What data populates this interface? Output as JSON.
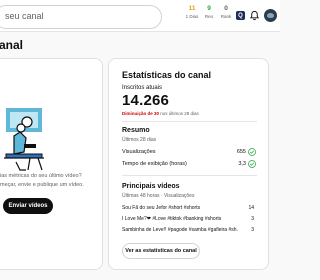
{
  "topbar": {
    "search_placeholder": "seu canal",
    "stats": [
      {
        "value": "11",
        "label": "1 Dias",
        "color": "amber"
      },
      {
        "value": "9",
        "label": "Reo",
        "color": "green"
      },
      {
        "value": "0",
        "label": "Rank",
        "color": "gray"
      }
    ],
    "badge": "Q",
    "icons": {
      "bell": "bell-icon",
      "avatar": "avatar"
    }
  },
  "page": {
    "title": "anal"
  },
  "left_card": {
    "prompt_lines": [
      "ias métricas do seu último vídeo?",
      "meçar, envie e publique um vídeo."
    ],
    "upload_button": "Enviar vídeos"
  },
  "analytics": {
    "title": "Estatísticas do canal",
    "subscribers_label": "Inscritos atuais",
    "subscribers_count": "14.266",
    "delta_value": "Diminuição de 30",
    "delta_suffix": "nos últimos 28 dias",
    "summary_title": "Resumo",
    "summary_period": "Últimos 28 dias",
    "summary_rows": [
      {
        "label": "Visualizações",
        "value": "655",
        "icon": "check-icon"
      },
      {
        "label": "Tempo de exibição (horas)",
        "value": "3,3",
        "icon": "check-icon"
      }
    ],
    "top_videos_title": "Principais vídeos",
    "top_videos_period": "Últimas 48 horas · Visualizações",
    "top_videos": [
      {
        "title": "Sou Fã do seu Jefor #short #shorts",
        "views": "14"
      },
      {
        "title": "I Love Me?❤ #Love #tiktok #banking #shorts",
        "views": "3"
      },
      {
        "title": "Sambinha de Leve!! #pagode #samba #gafieira #sh...",
        "views": "3"
      }
    ],
    "stats_button": "Ver as estatísticas do canal"
  },
  "colors": {
    "amber": "#e39d1c",
    "green": "#2ba640",
    "red": "#cc0000"
  }
}
